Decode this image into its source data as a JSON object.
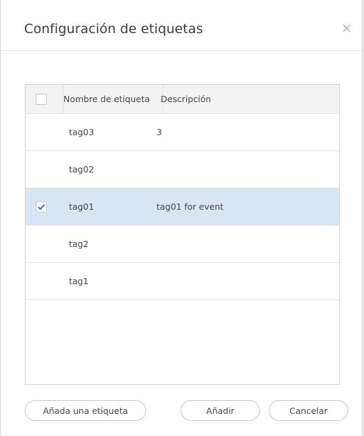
{
  "dialog": {
    "title": "Configuración de etiquetas",
    "close_icon": "close-icon"
  },
  "table": {
    "headers": {
      "name": "Nombre de etiqueta",
      "description": "Descripción"
    },
    "rows": [
      {
        "name": "tag03",
        "description": "3",
        "checked": false
      },
      {
        "name": "tag02",
        "description": "",
        "checked": false
      },
      {
        "name": "tag01",
        "description": "tag01 for event",
        "checked": true
      },
      {
        "name": "tag2",
        "description": "",
        "checked": false
      },
      {
        "name": "tag1",
        "description": "",
        "checked": false
      }
    ]
  },
  "buttons": {
    "add_tag": "Añada una etiqueta",
    "add": "Añadir",
    "cancel": "Cancelar"
  },
  "colors": {
    "selected_row": "#d7e6f2",
    "checkmark": "#2b78c5"
  }
}
